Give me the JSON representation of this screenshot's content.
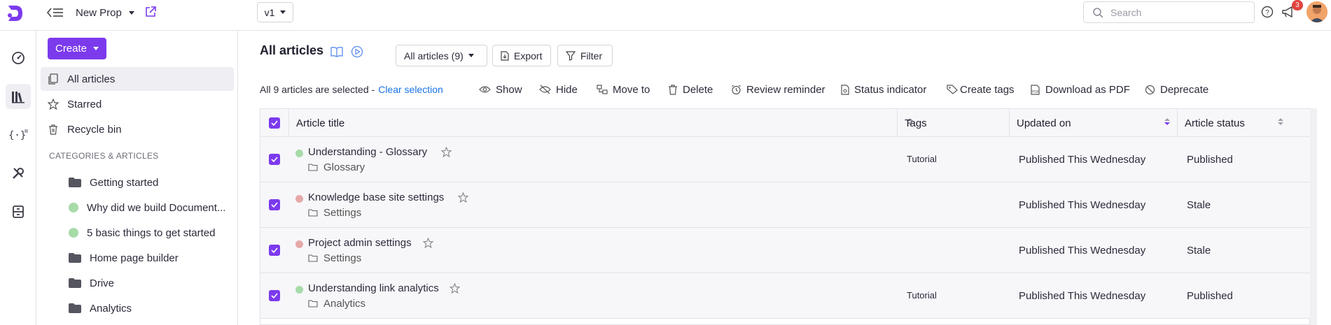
{
  "topbar": {
    "project_name": "New Prop",
    "version": "v1",
    "search_placeholder": "Search",
    "notification_count": "3"
  },
  "sidebar": {
    "create_label": "Create",
    "nav": [
      {
        "label": "All articles",
        "icon": "copy-icon"
      },
      {
        "label": "Starred",
        "icon": "star-icon"
      },
      {
        "label": "Recycle bin",
        "icon": "trash-icon"
      }
    ],
    "section_label": "CATEGORIES & ARTICLES",
    "tree": [
      {
        "label": "Getting started",
        "type": "folder"
      },
      {
        "label": "Why did we build Document...",
        "type": "article"
      },
      {
        "label": "5 basic things to get started",
        "type": "article"
      },
      {
        "label": "Home page builder",
        "type": "folder"
      },
      {
        "label": "Drive",
        "type": "folder"
      },
      {
        "label": "Analytics",
        "type": "folder"
      }
    ]
  },
  "main": {
    "title": "All articles",
    "filter_dropdown": "All articles (9)",
    "export_label": "Export",
    "filter_label": "Filter",
    "selection_text": "All 9 articles are selected -",
    "clear_selection": "Clear selection",
    "actions": [
      {
        "label": "Show",
        "icon": "eye-icon"
      },
      {
        "label": "Hide",
        "icon": "eye-off-icon"
      },
      {
        "label": "Move to",
        "icon": "move-icon"
      },
      {
        "label": "Delete",
        "icon": "trash-icon"
      },
      {
        "label": "Review reminder",
        "icon": "alarm-icon"
      },
      {
        "label": "Status indicator",
        "icon": "status-doc-icon"
      },
      {
        "label": "Create tags",
        "icon": "tag-icon"
      },
      {
        "label": "Download as PDF",
        "icon": "pdf-icon"
      },
      {
        "label": "Deprecate",
        "icon": "ban-icon"
      }
    ],
    "columns": [
      "Article title",
      "Tags",
      "Updated on",
      "Article status"
    ],
    "rows": [
      {
        "title": "Understanding - Glossary",
        "category": "Glossary",
        "tag": "Tutorial",
        "updated": "Published This Wednesday",
        "status": "Published",
        "dot_color": "#a7dba8"
      },
      {
        "title": "Knowledge base site settings",
        "category": "Settings",
        "tag": "",
        "updated": "Published This Wednesday",
        "status": "Stale",
        "dot_color": "#e5a9a9"
      },
      {
        "title": "Project admin settings",
        "category": "Settings",
        "tag": "",
        "updated": "Published This Wednesday",
        "status": "Stale",
        "dot_color": "#e5a9a9"
      },
      {
        "title": "Understanding link analytics",
        "category": "Analytics",
        "tag": "Tutorial",
        "updated": "Published This Wednesday",
        "status": "Published",
        "dot_color": "#a7dba8"
      }
    ]
  },
  "colors": {
    "accent": "#7c3aed",
    "link": "#1a73e8",
    "published_dot": "#a7dba8",
    "stale_dot": "#e5a9a9"
  }
}
